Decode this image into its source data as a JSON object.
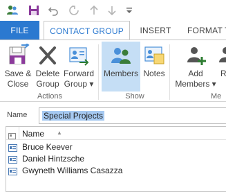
{
  "colors": {
    "accent": "#2b79d0",
    "qat_purple": "#8b3a9b",
    "pressed": "#c5def5",
    "selection": "#a6c9f1"
  },
  "quick_access": {
    "icons": [
      "people-icon",
      "save-icon",
      "undo-icon",
      "redo-icon",
      "up-arrow-icon",
      "down-arrow-icon",
      "customize-dropdown-icon"
    ]
  },
  "tabs": [
    {
      "label": "FILE"
    },
    {
      "label": "CONTACT GROUP"
    },
    {
      "label": "INSERT"
    },
    {
      "label": "FORMAT T"
    }
  ],
  "ribbon": {
    "buttons": [
      {
        "line1": "Save &",
        "line2": "Close"
      },
      {
        "line1": "Delete",
        "line2": "Group"
      },
      {
        "line1": "Forward",
        "line2": "Group ▾"
      },
      {
        "line1": "Members",
        "line2": ""
      },
      {
        "line1": "Notes",
        "line2": ""
      },
      {
        "line1": "Add",
        "line2": "Members ▾"
      },
      {
        "line1": "R",
        "line2": ""
      }
    ],
    "groups": [
      "Actions",
      "Show",
      "Me"
    ]
  },
  "name_field": {
    "label": "Name",
    "value": "Special Projects"
  },
  "list": {
    "column_header": "Name",
    "sort_indicator": "▲",
    "rows": [
      {
        "name": "Bruce Keever"
      },
      {
        "name": "Daniel Hintzsche"
      },
      {
        "name": "Gwyneth Williams Casazza"
      }
    ]
  }
}
